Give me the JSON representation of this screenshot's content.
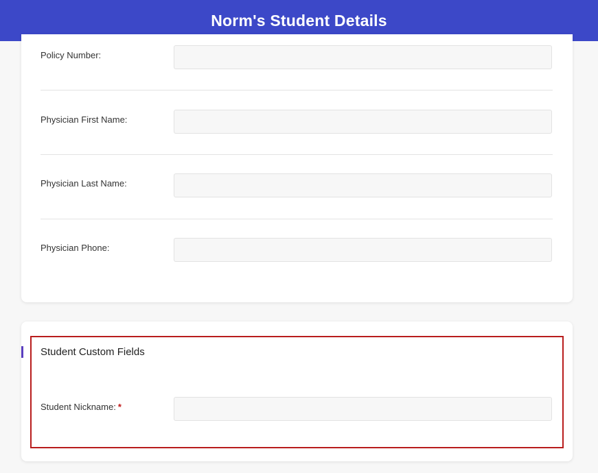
{
  "header": {
    "title": "Norm's Student Details"
  },
  "medical_fields": [
    {
      "label": "Policy Number:",
      "value": ""
    },
    {
      "label": "Physician First Name:",
      "value": ""
    },
    {
      "label": "Physician Last Name:",
      "value": ""
    },
    {
      "label": "Physician Phone:",
      "value": ""
    }
  ],
  "custom_fields": {
    "section_title": "Student Custom Fields",
    "nickname_label": "Student Nickname:",
    "required_marker": "*",
    "nickname_value": ""
  },
  "colors": {
    "header_bg": "#3c48c8",
    "highlight_border": "#b81c1c",
    "required": "#c01818",
    "section_marker": "#5a3fc0"
  }
}
